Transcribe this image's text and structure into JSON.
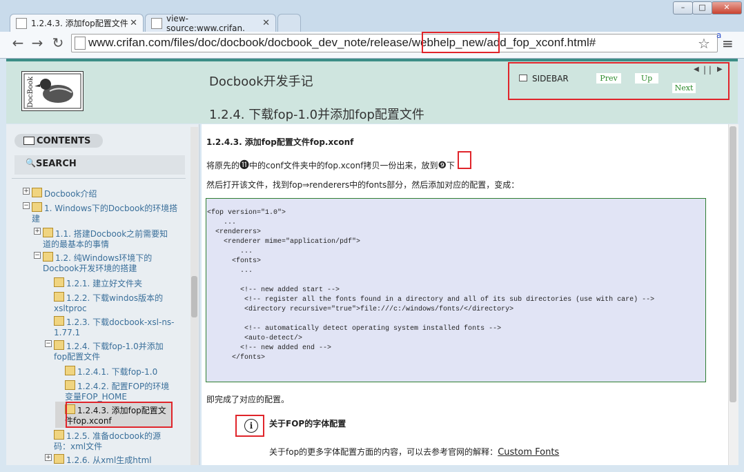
{
  "browser": {
    "tabs": [
      {
        "title": "1.2.4.3. 添加fop配置文件"
      },
      {
        "title": "view-source:www.crifan."
      }
    ],
    "url": "www.crifan.com/files/doc/docbook/docbook_dev_note/release/webhelp_new/add_fop_xconf.html#",
    "window_buttons": [
      "–",
      "□",
      "✕"
    ]
  },
  "header": {
    "book_title": "Docbook开发手记",
    "chapter_title": "1.2.4. 下载fop-1.0并添加fop配置文件",
    "sidebar_label": "SIDEBAR",
    "prev": "Prev",
    "up": "Up",
    "next": "Next",
    "logo_text": "DocBook"
  },
  "sidebar": {
    "contents": "CONTENTS",
    "search": "SEARCH",
    "items": [
      "Docbook介绍",
      "1. Windows下的Docbook的环境搭建",
      "1.1. 搭建Docbook之前需要知道的最基本的事情",
      "1.2. 纯Windows环境下的Docbook开发环境的搭建",
      "1.2.1. 建立好文件夹",
      "1.2.2. 下载windos版本的xsltproc",
      "1.2.3. 下载docbook-xsl-ns-1.77.1",
      "1.2.4. 下载fop-1.0并添加fop配置文件",
      "1.2.4.1. 下载fop-1.0",
      "1.2.4.2. 配置FOP的环境变量FOP_HOME",
      "1.2.4.3. 添加fop配置文件fop.xconf",
      "1.2.5. 准备docbook的源码：xml文件",
      "1.2.6. 从xml生成html"
    ]
  },
  "content": {
    "heading": "1.2.4.3. 添加fop配置文件fop.xconf",
    "p1_a": "将原先的",
    "p1_b": "中的conf文件夹中的fop.xconf拷贝一份出来，放到",
    "p1_c": "下",
    "callout_11": "⓫",
    "callout_9": "❾",
    "p2": "然后打开该文件，找到fop⇒renderers中的fonts部分，然后添加对应的配置，变成：",
    "code": "<fop version=\"1.0\">\n    ...\n  <renderers>\n    <renderer mime=\"application/pdf\">\n        ...\n      <fonts>\n        ...\n\n        <!-- new added start -->\n         <!-- register all the fonts found in a directory and all of its sub directories (use with care) -->\n         <directory recursive=\"true\">file:///c:/windows/fonts/</directory>\n\n         <!-- automatically detect operating system installed fonts -->\n         <auto-detect/>\n        <!-- new added end -->\n      </fonts>",
    "p3": "即完成了对应的配置。",
    "note_title": "关于FOP的字体配置",
    "note_text": "关于fop的更多字体配置方面的内容，可以去参考官网的解释：",
    "note_link": "Custom Fonts"
  }
}
